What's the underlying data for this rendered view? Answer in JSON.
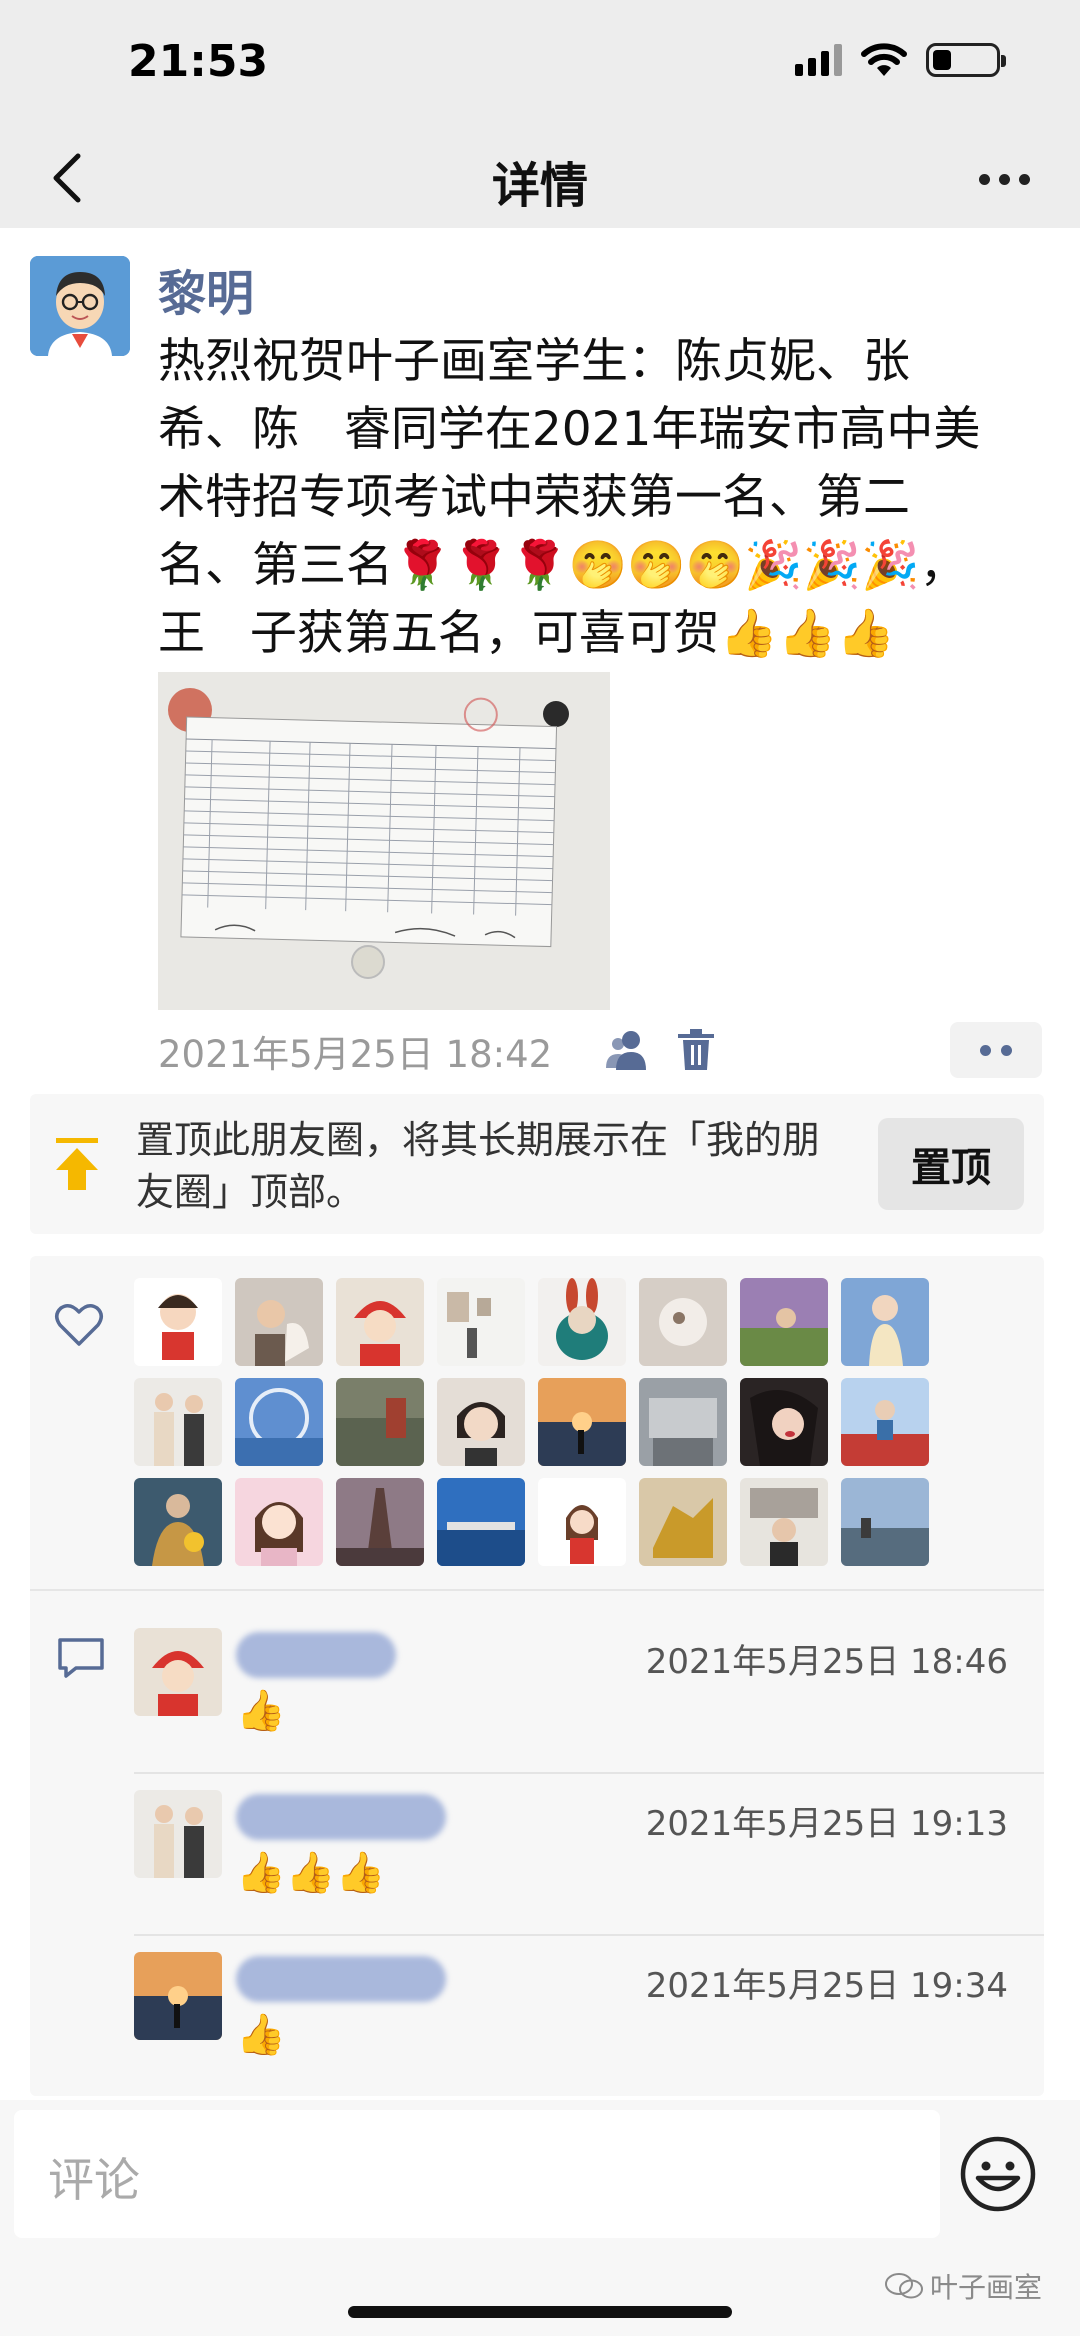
{
  "status_bar": {
    "time": "21:53"
  },
  "nav": {
    "title": "详情"
  },
  "post": {
    "author": "黎明",
    "text": "热烈祝贺叶子画室学生：陈贞妮、张   \n希、陈   睿同学在2021年瑞安市高中美\n术特招专项考试中荣获第一名、第二\n名、第三名🌹🌹🌹🤭🤭🤭🎉🎉🎉，\n王   子获第五名，可喜可贺👍👍👍",
    "time": "2021年5月25日 18:42"
  },
  "pin": {
    "text": "置顶此朋友圈，将其长期展示在「我的朋友圈」顶部。",
    "button": "置顶"
  },
  "comments": [
    {
      "time": "2021年5月25日 18:46",
      "text": "👍"
    },
    {
      "time": "2021年5月25日 19:13",
      "text": "👍👍👍"
    },
    {
      "time": "2021年5月25日 19:34",
      "text": "👍"
    }
  ],
  "comment_bar": {
    "placeholder": "评论"
  },
  "watermark": {
    "text": "叶子画室"
  },
  "colors": {
    "accent": "#576b95",
    "nav_bg": "#ededed",
    "panel_bg": "#f7f7f7"
  },
  "icons": [
    "back-arrow-icon",
    "wifi-icon",
    "signal-icon",
    "battery-icon",
    "more-icon",
    "privacy-icon",
    "trash-icon",
    "pin-up-icon",
    "heart-icon",
    "comment-icon",
    "emoji-icon",
    "wechat-icon"
  ]
}
